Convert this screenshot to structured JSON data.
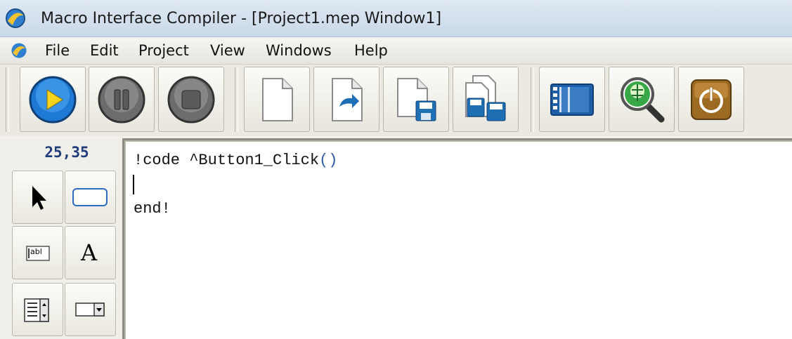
{
  "window": {
    "title": "Macro Interface Compiler - [Project1.mep Window1]",
    "icon": "macro-app-icon"
  },
  "menu": {
    "items": [
      "File",
      "Edit",
      "Project",
      "View",
      "Windows",
      "Help"
    ]
  },
  "toolbar": {
    "buttons": [
      {
        "name": "run-button",
        "icon": "play-icon",
        "color": "#1e7fd6"
      },
      {
        "name": "pause-button",
        "icon": "pause-icon",
        "color": "#6e6e6e"
      },
      {
        "name": "stop-button",
        "icon": "stop-icon",
        "color": "#6e6e6e"
      },
      {
        "name": "new-file-button",
        "icon": "new-page-icon"
      },
      {
        "name": "open-file-button",
        "icon": "open-page-icon"
      },
      {
        "name": "save-button",
        "icon": "save-icon"
      },
      {
        "name": "save-all-button",
        "icon": "save-all-icon"
      },
      {
        "name": "form-designer-button",
        "icon": "film-strip-icon"
      },
      {
        "name": "debug-button",
        "icon": "magnifier-bug-icon"
      },
      {
        "name": "power-button",
        "icon": "power-icon",
        "color": "#a0702a"
      }
    ]
  },
  "palette": {
    "coords": "25,35",
    "tools": [
      {
        "name": "pointer-tool",
        "icon": "arrow-cursor-icon"
      },
      {
        "name": "button-tool",
        "icon": "button-rectangle-icon"
      },
      {
        "name": "textbox-tool",
        "icon": "textbox-abl-icon",
        "label": "abl"
      },
      {
        "name": "label-tool",
        "icon": "label-a-icon",
        "label": "A"
      },
      {
        "name": "listbox-tool",
        "icon": "listbox-icon"
      },
      {
        "name": "combobox-tool",
        "icon": "combobox-icon"
      }
    ]
  },
  "editor": {
    "line1_text": "!code ^Button1_Click",
    "line1_parens": "()",
    "line3_text": "end!"
  }
}
